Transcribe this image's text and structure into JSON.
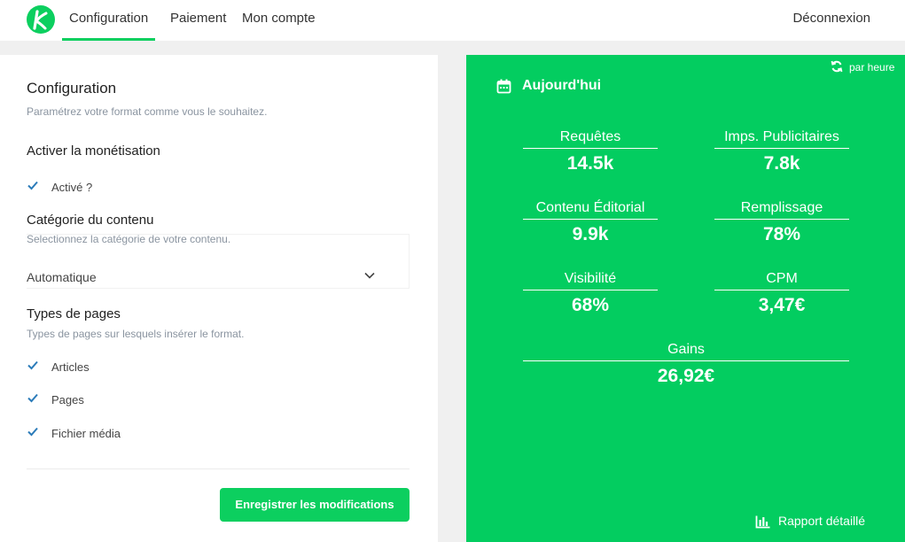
{
  "nav": {
    "tabs": [
      {
        "label": "Configuration",
        "active": true
      },
      {
        "label": "Paiement",
        "active": false
      },
      {
        "label": "Mon compte",
        "active": false
      }
    ],
    "logout": "Déconnexion"
  },
  "config": {
    "title": "Configuration",
    "subtitle": "Paramétrez votre format comme vous le souhaitez.",
    "monetisation": {
      "title": "Activer la monétisation",
      "checkbox": {
        "label": "Activé ?",
        "checked": true
      }
    },
    "category": {
      "title": "Catégorie du contenu",
      "subtitle": "Selectionnez la catégorie de votre contenu.",
      "selected": "Automatique"
    },
    "page_types": {
      "title": "Types de pages",
      "subtitle": "Types de pages sur lesquels insérer le format.",
      "items": [
        {
          "label": "Articles",
          "checked": true
        },
        {
          "label": "Pages",
          "checked": true
        },
        {
          "label": "Fichier média",
          "checked": true
        }
      ]
    },
    "save_label": "Enregistrer les modifications"
  },
  "stats": {
    "refresh_label": "par heure",
    "period": "Aujourd'hui",
    "items": [
      {
        "label": "Requêtes",
        "value": "14.5k"
      },
      {
        "label": "Imps. Publicitaires",
        "value": "7.8k"
      },
      {
        "label": "Contenu Éditorial",
        "value": "9.9k"
      },
      {
        "label": "Remplissage",
        "value": "78%"
      },
      {
        "label": "Visibilité",
        "value": "68%"
      },
      {
        "label": "CPM",
        "value": "3,47€"
      },
      {
        "label": "Gains",
        "value": "26,92€"
      }
    ],
    "report_label": "Rapport détaillé"
  },
  "colors": {
    "brand_green": "#03cd60",
    "text_muted": "#8a94a0",
    "check_blue": "#2b7bb9"
  },
  "icons": [
    "logo-icon",
    "refresh-icon",
    "calendar-icon",
    "check-icon",
    "chevron-down-icon",
    "bar-chart-icon"
  ]
}
